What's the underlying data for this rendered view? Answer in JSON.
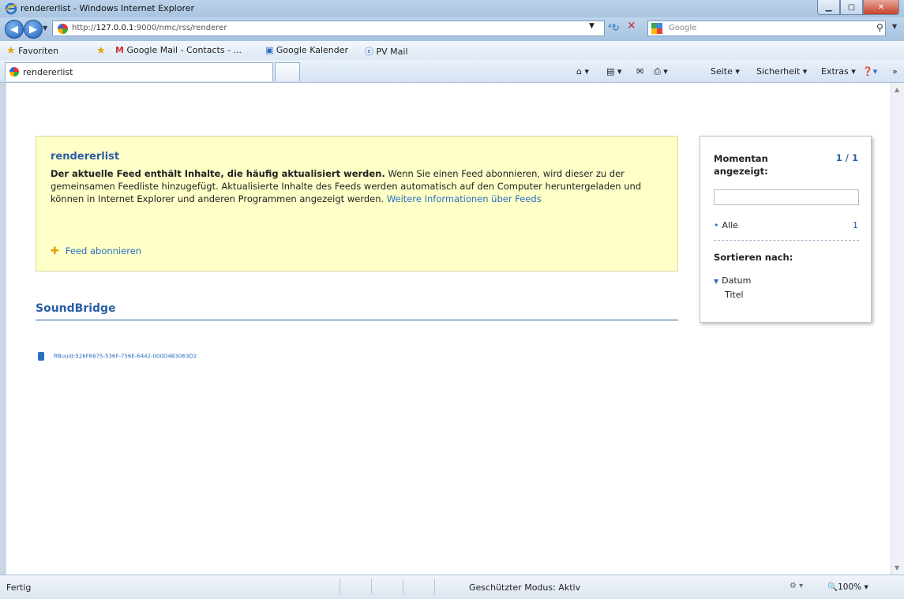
{
  "window": {
    "title": "rendererlist - Windows Internet Explorer"
  },
  "address": {
    "url_prefix": "http://",
    "url_host": "127.0.0.1",
    "url_rest": ":9000/nmc/rss/renderer",
    "search_placeholder": "Google"
  },
  "favorites": {
    "label": "Favoriten",
    "items": [
      "Google Mail - Contacts - ...",
      "Google Kalender",
      "PV Mail"
    ]
  },
  "tab": {
    "label": "rendererlist"
  },
  "commands": {
    "page": "Seite ▾",
    "safety": "Sicherheit ▾",
    "tools": "Extras ▾"
  },
  "feed": {
    "info_title": "rendererlist",
    "info_bold": "Der aktuelle Feed enthält Inhalte, die häufig aktualisiert werden.",
    "info_body": " Wenn Sie einen Feed abonnieren, wird dieser zu der gemeinsamen Feedliste hinzugefügt. Aktualisierte Inhalte des Feeds werden automatisch auf den Computer heruntergeladen und können in Internet Explorer und anderen Programmen angezeigt werden. ",
    "info_link": "Weitere Informationen über Feeds",
    "subscribe_label": "Feed abonnieren",
    "section_title": "SoundBridge",
    "item": "RBuuid:526F6875-536F-756E-6442-000D4B3063D2"
  },
  "sidepanel": {
    "heading": "Momentan angezeigt:",
    "count": "1 / 1",
    "filter_all": "Alle",
    "filter_all_count": "1",
    "sort_heading": "Sortieren nach:",
    "sort_date": "Datum",
    "sort_title": "Titel"
  },
  "status": {
    "text": "Fertig",
    "mode": "Geschützter Modus: Aktiv",
    "zoom": "100%"
  }
}
